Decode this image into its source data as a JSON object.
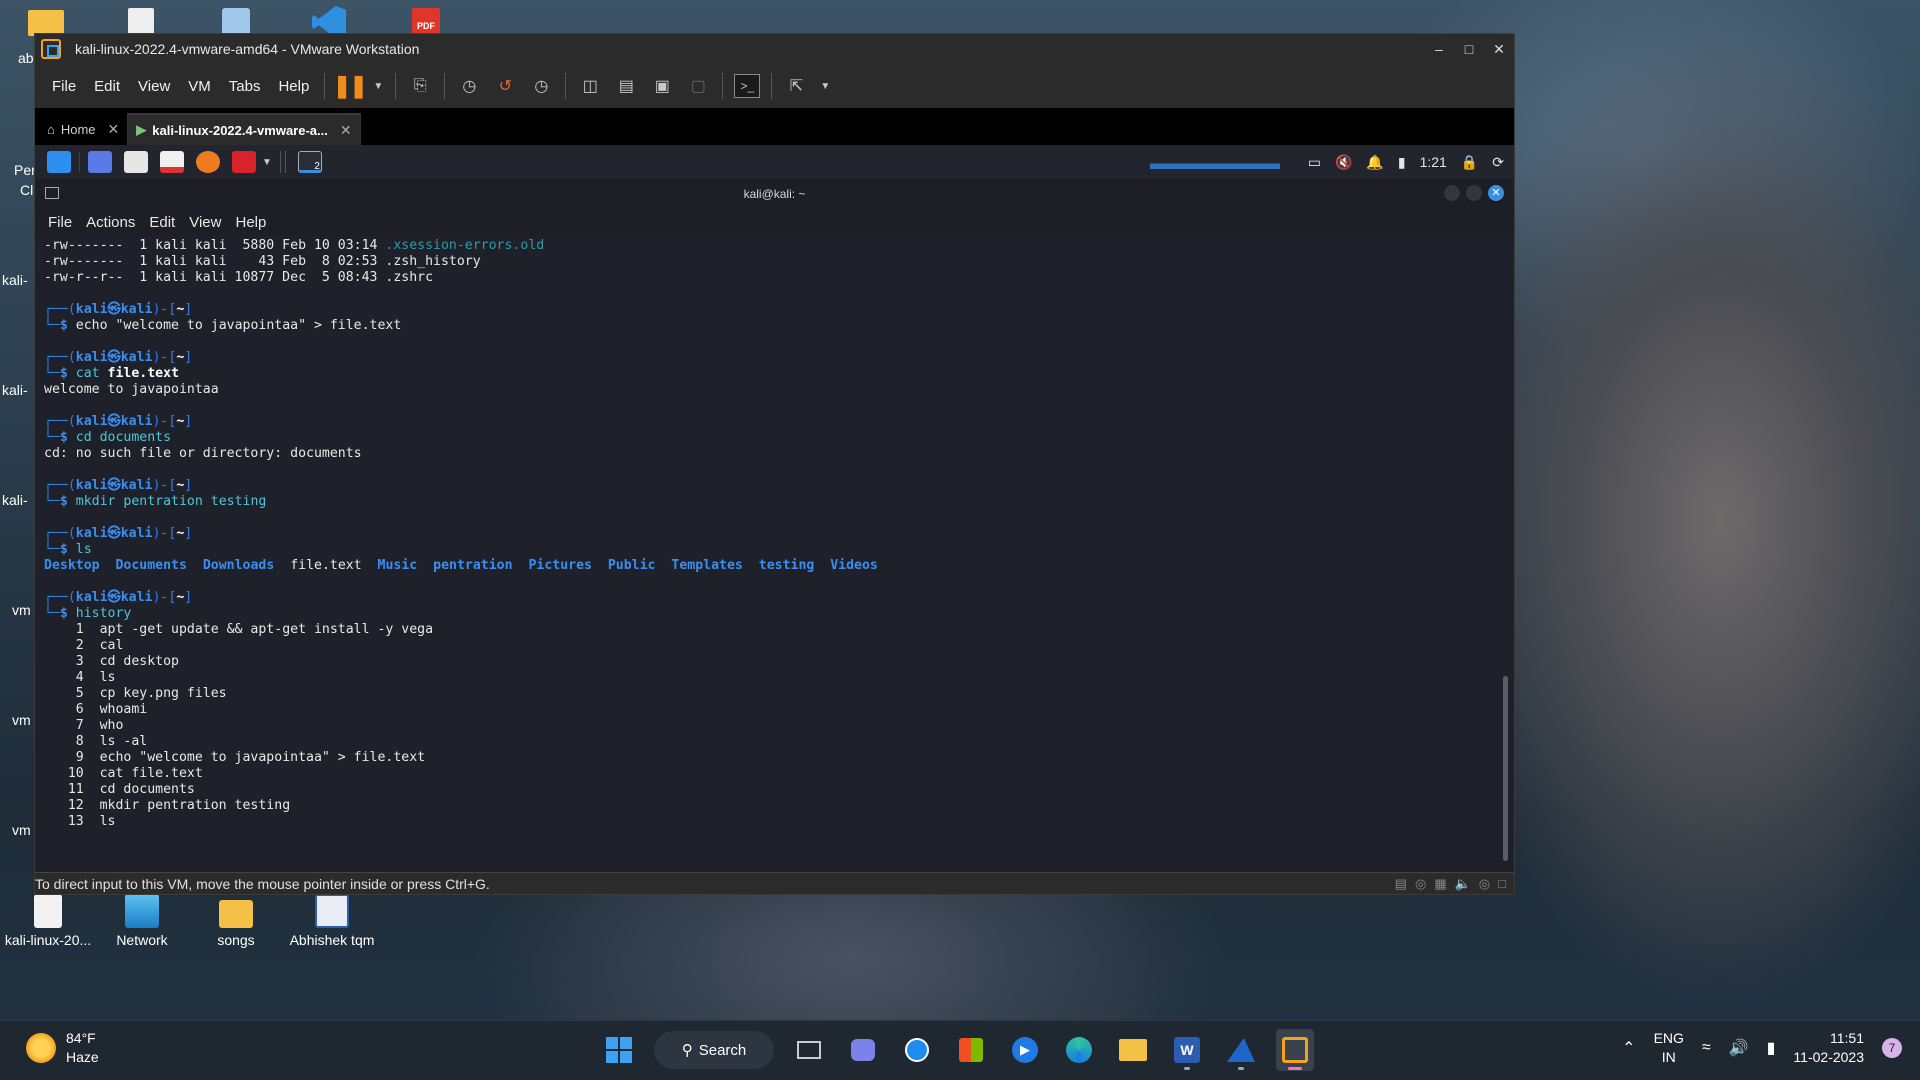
{
  "desktop": {
    "top_icons": [
      {
        "name": "folder-icon",
        "color": "#f5c046"
      },
      {
        "name": "document-icon",
        "color": "#e8e8e8"
      },
      {
        "name": "recycle-bin-icon",
        "color": "#9fc8ec"
      },
      {
        "name": "vscode-icon",
        "color": "#2f8fe0"
      },
      {
        "name": "pdf-icon",
        "color": "#e0352b"
      }
    ],
    "edge_labels": [
      "ab",
      "Per",
      "Cl",
      "kali-",
      "kali-",
      "kali-",
      "vm",
      "vm",
      "vm"
    ],
    "bottom_icons": [
      {
        "label": "kali-linux-20...",
        "icon": "file-icon"
      },
      {
        "label": "Network",
        "icon": "network-icon"
      },
      {
        "label": "songs",
        "icon": "folder-icon"
      },
      {
        "label": "Abhishek tqm",
        "icon": "word-doc-icon"
      }
    ]
  },
  "vmware": {
    "title": "kali-linux-2022.4-vmware-amd64 - VMware Workstation",
    "menu": [
      "File",
      "Edit",
      "View",
      "VM",
      "Tabs",
      "Help"
    ],
    "tabs": [
      {
        "label": "Home",
        "icon": "home-icon"
      },
      {
        "label": "kali-linux-2022.4-vmware-a...",
        "icon": "vm-icon"
      }
    ],
    "status_text": "To direct input to this VM, move the mouse pointer inside or press Ctrl+G."
  },
  "kali_panel": {
    "clock": "1:21",
    "workspace_badge": "2"
  },
  "terminal": {
    "title": "kali@kali: ~",
    "menu": [
      "File",
      "Actions",
      "Edit",
      "View",
      "Help"
    ],
    "ls_rows": [
      {
        "perm": "-rw-------",
        "rest": "  1 kali kali  5880 Feb 10 03:14 ",
        "name": ".xsession-errors.old"
      },
      {
        "perm": "-rw-------",
        "rest": "  1 kali kali    43 Feb  8 02:53 ",
        "name": ".zsh_history"
      },
      {
        "perm": "-rw-r--r--",
        "rest": "  1 kali kali 10877 Dec  5 08:43 ",
        "name": ".zshrc"
      }
    ],
    "prompt": {
      "user": "kali",
      "host": "kali",
      "dir": "~"
    },
    "cmd_echo": "echo \"welcome to javapointaa\" > file.text",
    "cmd_cat": "cat",
    "cmd_cat_arg": "file.text",
    "out_cat": "welcome to javapointaa",
    "cmd_cd": "cd documents",
    "out_cd": "cd: no such file or directory: documents",
    "cmd_mkdir": "mkdir pentration testing",
    "cmd_ls": "ls",
    "ls_output": [
      {
        "name": "Desktop",
        "dir": true
      },
      {
        "name": "Documents",
        "dir": true
      },
      {
        "name": "Downloads",
        "dir": true
      },
      {
        "name": "file.text",
        "dir": false
      },
      {
        "name": "Music",
        "dir": true
      },
      {
        "name": "pentration",
        "dir": true
      },
      {
        "name": "Pictures",
        "dir": true
      },
      {
        "name": "Public",
        "dir": true
      },
      {
        "name": "Templates",
        "dir": true
      },
      {
        "name": "testing",
        "dir": true
      },
      {
        "name": "Videos",
        "dir": true
      }
    ],
    "cmd_history": "history",
    "history": [
      {
        "n": "1",
        "cmd": "apt -get update && apt-get install -y vega"
      },
      {
        "n": "2",
        "cmd": "cal"
      },
      {
        "n": "3",
        "cmd": "cd desktop"
      },
      {
        "n": "4",
        "cmd": "ls"
      },
      {
        "n": "5",
        "cmd": "cp key.png files"
      },
      {
        "n": "6",
        "cmd": "whoami"
      },
      {
        "n": "7",
        "cmd": "who"
      },
      {
        "n": "8",
        "cmd": "ls -al"
      },
      {
        "n": "9",
        "cmd": "echo \"welcome to javapointaa\" > file.text"
      },
      {
        "n": "10",
        "cmd": "cat file.text"
      },
      {
        "n": "11",
        "cmd": "cd documents"
      },
      {
        "n": "12",
        "cmd": "mkdir pentration testing"
      },
      {
        "n": "13",
        "cmd": "ls"
      }
    ]
  },
  "taskbar": {
    "weather_temp": "84°F",
    "weather_desc": "Haze",
    "search_label": "Search",
    "lang": "ENG",
    "region": "IN",
    "time": "11:51",
    "date": "11-02-2023",
    "notification_count": "7",
    "accent": "#ff6fb4"
  }
}
